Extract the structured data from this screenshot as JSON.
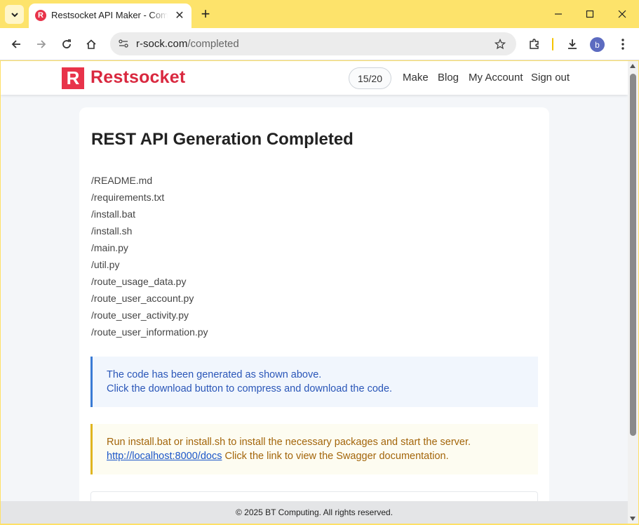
{
  "browser": {
    "tab_title": "Restsocket API Maker - Completed",
    "tab_favicon_letter": "R",
    "url_host": "r-sock.com",
    "url_path": "/completed",
    "profile_initial": "b"
  },
  "site": {
    "logo_letter": "R",
    "logo_text": "Restsocket",
    "credits": "15/20",
    "nav": [
      "Make",
      "Blog",
      "My Account",
      "Sign out"
    ]
  },
  "page": {
    "title": "REST API Generation Completed",
    "files": [
      "/README.md",
      "/requirements.txt",
      "/install.bat",
      "/install.sh",
      "/main.py",
      "/util.py",
      "/route_usage_data.py",
      "/route_user_account.py",
      "/route_user_activity.py",
      "/route_user_information.py"
    ],
    "info_line1": "The code has been generated as shown above.",
    "info_line2": "Click the download button to compress and download the code.",
    "warn_line1": "Run install.bat or install.sh to install the necessary packages and start the server.",
    "warn_link": "http://localhost:8000/docs",
    "warn_link_suffix": " Click the link to view the Swagger documentation."
  },
  "footer": {
    "text": "© 2025 BT Computing. All rights reserved."
  },
  "colors": {
    "brand": "#d9283f",
    "chrome": "#fde36b",
    "info_border": "#3a7bd5",
    "warn_border": "#e0b520"
  }
}
